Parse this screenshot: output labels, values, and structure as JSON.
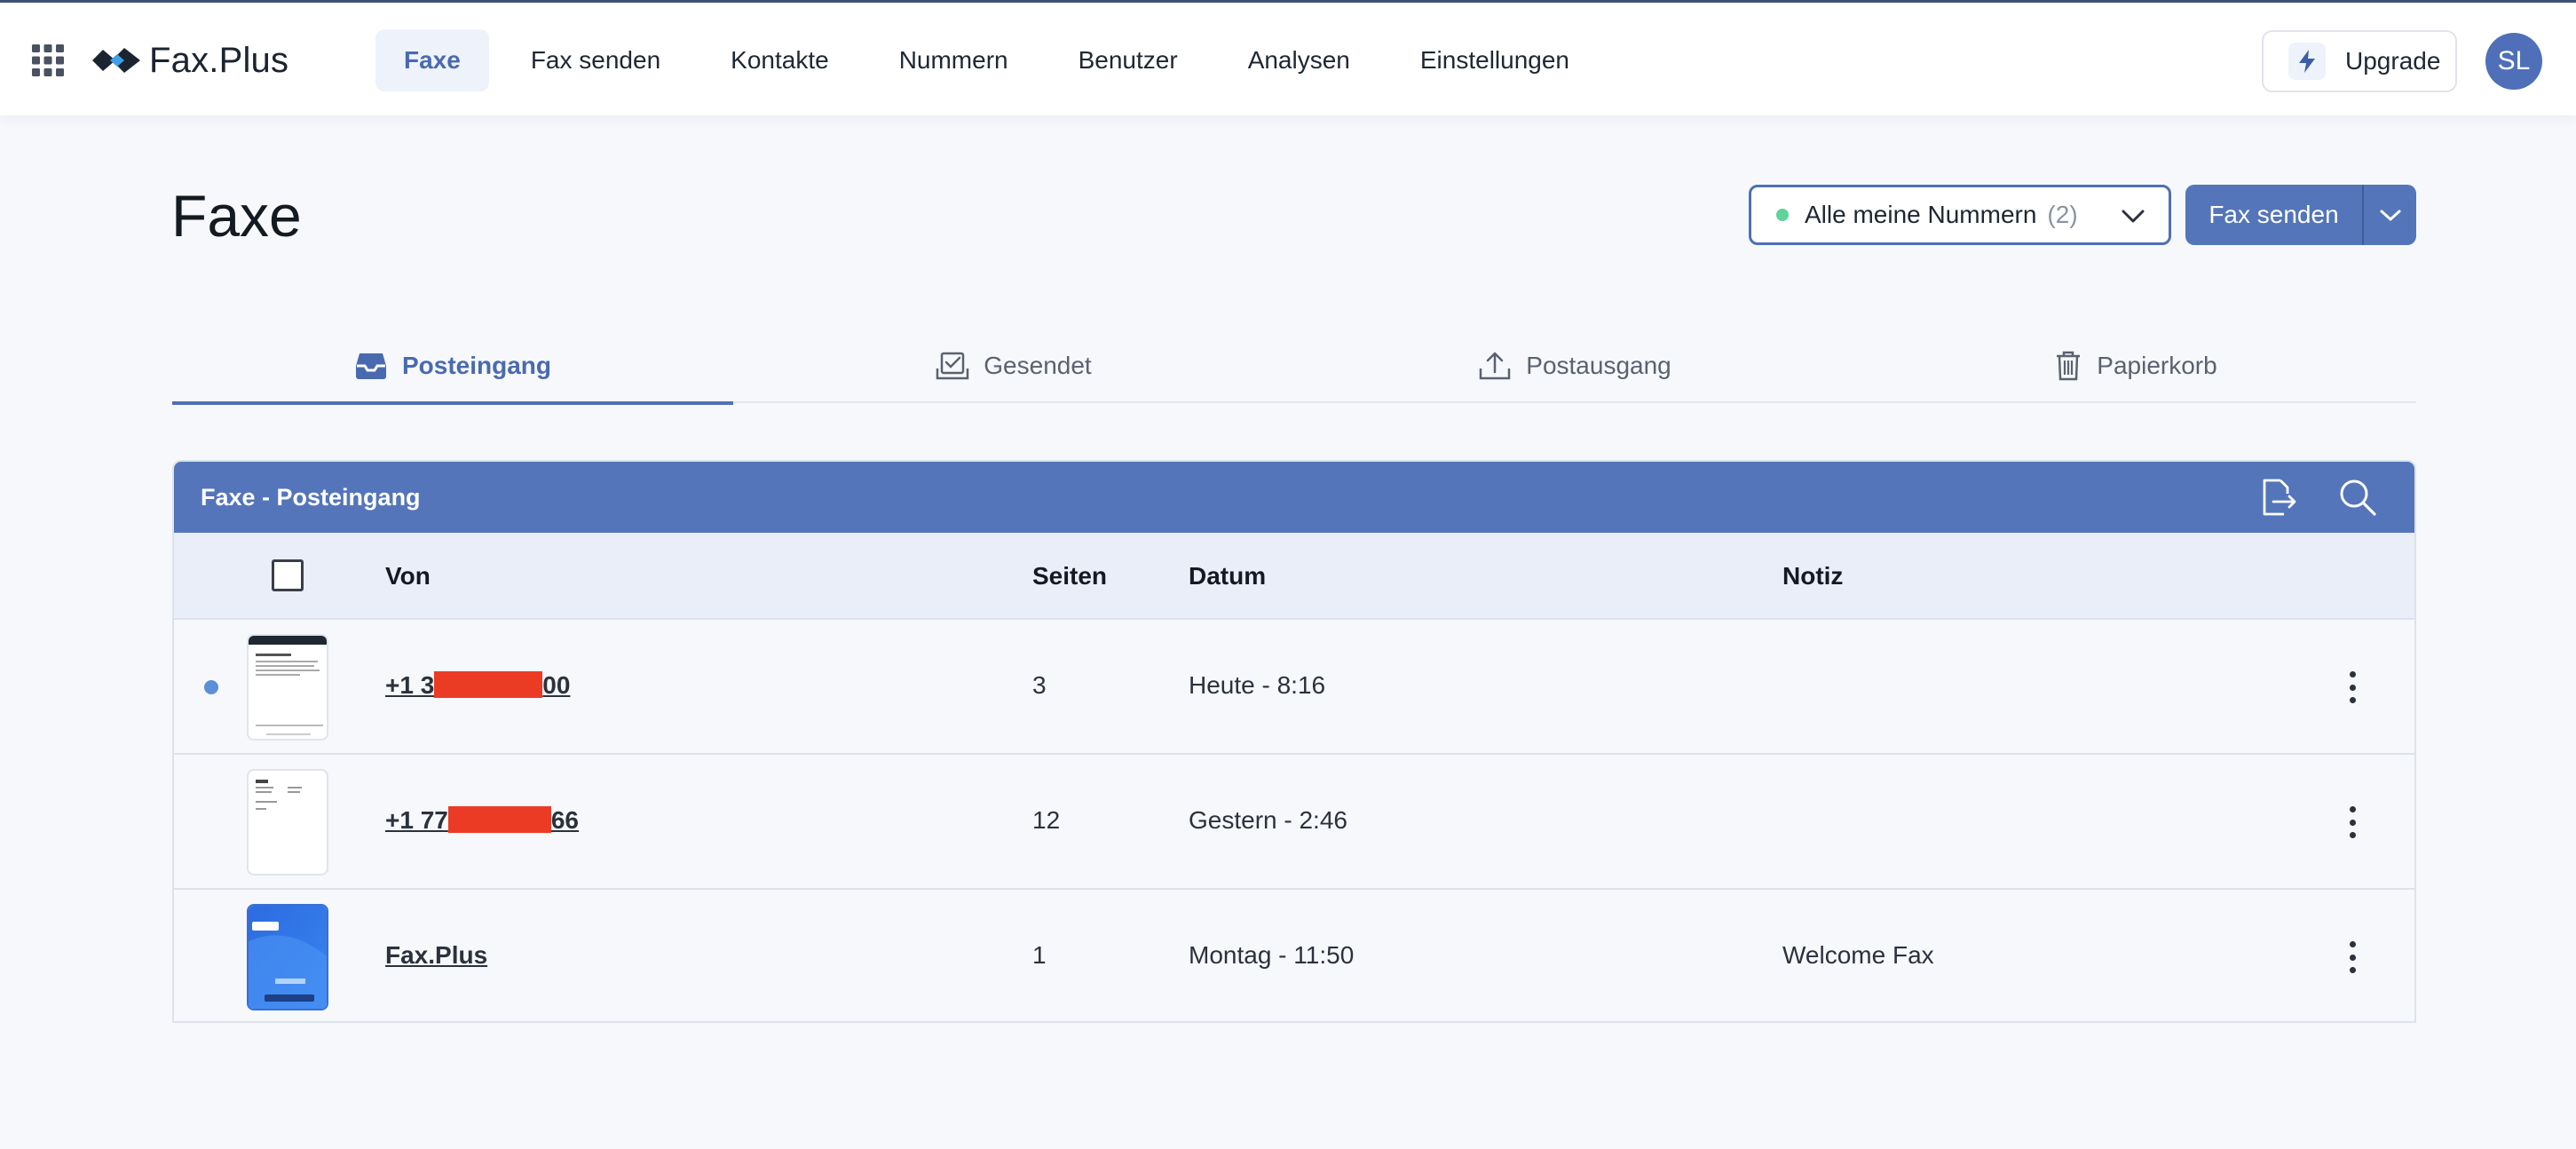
{
  "app": {
    "logo_text": "Fax.Plus"
  },
  "nav": {
    "items": [
      {
        "label": "Faxe",
        "active": true
      },
      {
        "label": "Fax senden",
        "active": false
      },
      {
        "label": "Kontakte",
        "active": false
      },
      {
        "label": "Nummern",
        "active": false
      },
      {
        "label": "Benutzer",
        "active": false
      },
      {
        "label": "Analysen",
        "active": false
      },
      {
        "label": "Einstellungen",
        "active": false
      }
    ],
    "upgrade_label": "Upgrade",
    "avatar_initials": "SL"
  },
  "page": {
    "title": "Faxe",
    "number_select": {
      "label": "Alle meine Nummern",
      "count": "(2)"
    },
    "send_button_label": "Fax senden"
  },
  "tabs": [
    {
      "label": "Posteingang",
      "icon": "inbox-icon",
      "active": true
    },
    {
      "label": "Gesendet",
      "icon": "sent-check-icon",
      "active": false
    },
    {
      "label": "Postausgang",
      "icon": "upload-icon",
      "active": false
    },
    {
      "label": "Papierkorb",
      "icon": "trash-icon",
      "active": false
    }
  ],
  "table": {
    "title": "Faxe - Posteingang",
    "columns": {
      "from": "Von",
      "pages": "Seiten",
      "date": "Datum",
      "note": "Notiz"
    },
    "rows": [
      {
        "from_prefix": "+1 3",
        "from_suffix": "00",
        "redacted": true,
        "pages": "3",
        "date": "Heute - 8:16",
        "note": "",
        "unread": true,
        "thumb": "document"
      },
      {
        "from_prefix": "+1 77",
        "from_suffix": "66",
        "redacted": true,
        "pages": "12",
        "date": "Gestern - 2:46",
        "note": "",
        "unread": false,
        "thumb": "letter"
      },
      {
        "from_prefix": "Fax.Plus",
        "from_suffix": "",
        "redacted": false,
        "pages": "1",
        "date": "Montag - 11:50",
        "note": "Welcome Fax",
        "unread": false,
        "thumb": "welcome"
      }
    ]
  },
  "colors": {
    "accent": "#5475ba",
    "nav_active_text": "#4a6aaf",
    "status_green": "#5fd39a",
    "unread_dot": "#5b8fd6",
    "redaction": "#ec3b24"
  }
}
